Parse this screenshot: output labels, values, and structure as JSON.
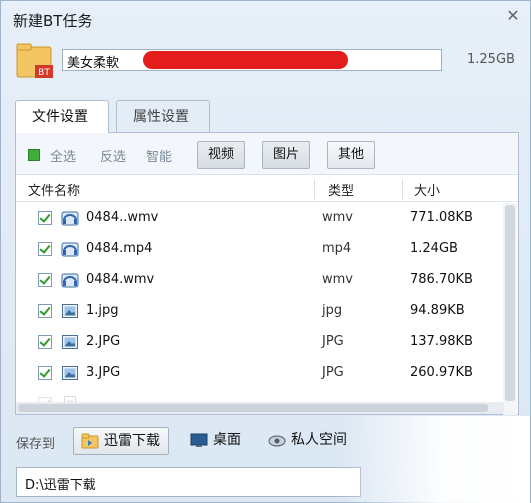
{
  "window": {
    "title": "新建BT任务"
  },
  "task": {
    "icon_badge": "BT",
    "name_value": "美女柔軟",
    "total_size": "1.25GB"
  },
  "tabs": [
    {
      "label": "文件设置",
      "active": true
    },
    {
      "label": "属性设置",
      "active": false
    }
  ],
  "filter": {
    "select_all": "全选",
    "invert": "反选",
    "smart": "智能",
    "buttons": [
      "视频",
      "图片",
      "其他"
    ]
  },
  "table": {
    "headers": {
      "name": "文件名称",
      "type": "类型",
      "size": "大小"
    },
    "rows": [
      {
        "icon": "video-file-icon",
        "name": "0484..wmv",
        "type": "wmv",
        "size": "771.08KB"
      },
      {
        "icon": "video-file-icon",
        "name": "0484.mp4",
        "type": "mp4",
        "size": "1.24GB"
      },
      {
        "icon": "video-file-icon",
        "name": "0484.wmv",
        "type": "wmv",
        "size": "786.70KB"
      },
      {
        "icon": "image-file-icon",
        "name": "1.jpg",
        "type": "jpg",
        "size": "94.89KB"
      },
      {
        "icon": "image-file-icon",
        "name": "2.JPG",
        "type": "JPG",
        "size": "137.98KB"
      },
      {
        "icon": "image-file-icon",
        "name": "3.JPG",
        "type": "JPG",
        "size": "260.97KB"
      }
    ]
  },
  "save": {
    "label": "保存到",
    "locations": [
      {
        "label": "迅雷下载",
        "icon": "folder-icon"
      },
      {
        "label": "桌面",
        "icon": "desktop-icon"
      },
      {
        "label": "私人空间",
        "icon": "private-space-icon"
      }
    ],
    "path": "D:\\迅雷下载"
  },
  "colors": {
    "accent_green": "#3fae3a",
    "redaction": "#e31c1c",
    "window_bg": "#dfe9f3"
  }
}
